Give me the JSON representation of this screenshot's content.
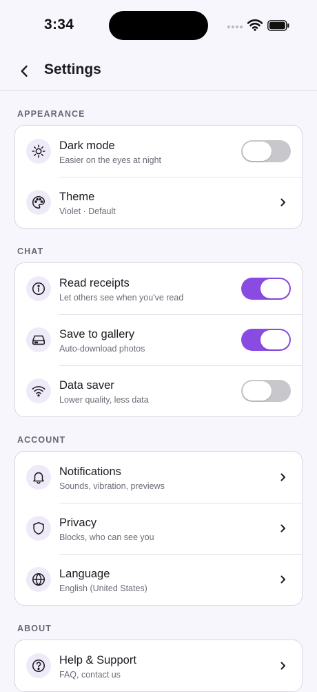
{
  "status": {
    "time": "3:34"
  },
  "nav": {
    "title": "Settings"
  },
  "colors": {
    "accent": "#8A4BE3",
    "toggle_off": "#C8C8CC",
    "icon_bg": "#EFEAF8",
    "background": "#F8F6FD"
  },
  "sections": [
    {
      "label": "APPEARANCE",
      "rows": [
        {
          "icon": "sun-icon",
          "title": "Dark mode",
          "subtitle": "Easier on the eyes at night",
          "control": "toggle",
          "on": false
        },
        {
          "icon": "palette-icon",
          "title": "Theme",
          "subtitle": "Violet · Default",
          "control": "chevron"
        }
      ]
    },
    {
      "label": "CHAT",
      "rows": [
        {
          "icon": "info-icon",
          "title": "Read receipts",
          "subtitle": "Let others see when you've read",
          "control": "toggle",
          "on": true
        },
        {
          "icon": "drive-icon",
          "title": "Save to gallery",
          "subtitle": "Auto-download photos",
          "control": "toggle",
          "on": true
        },
        {
          "icon": "wifi-icon",
          "title": "Data saver",
          "subtitle": "Lower quality, less data",
          "control": "toggle",
          "on": false
        }
      ]
    },
    {
      "label": "ACCOUNT",
      "rows": [
        {
          "icon": "bell-icon",
          "title": "Notifications",
          "subtitle": "Sounds, vibration, previews",
          "control": "chevron"
        },
        {
          "icon": "shield-icon",
          "title": "Privacy",
          "subtitle": "Blocks, who can see you",
          "control": "chevron"
        },
        {
          "icon": "globe-icon",
          "title": "Language",
          "subtitle": "English (United States)",
          "control": "chevron"
        }
      ]
    },
    {
      "label": "ABOUT",
      "rows": [
        {
          "icon": "help-icon",
          "title": "Help & Support",
          "subtitle": "FAQ, contact us",
          "control": "chevron"
        }
      ]
    }
  ]
}
